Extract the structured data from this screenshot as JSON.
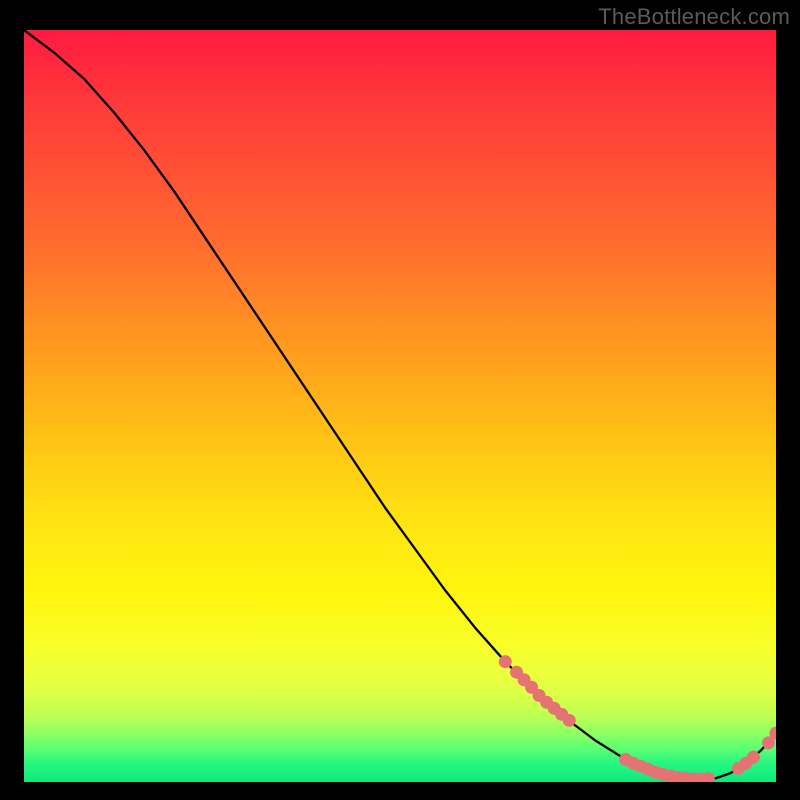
{
  "watermark": "TheBottleneck.com",
  "chart_data": {
    "type": "line",
    "title": "",
    "xlabel": "",
    "ylabel": "",
    "xlim": [
      0,
      100
    ],
    "ylim": [
      0,
      100
    ],
    "grid": false,
    "legend": false,
    "series": [
      {
        "name": "bottleneck-curve",
        "x": [
          0,
          4,
          8,
          12,
          16,
          20,
          24,
          28,
          32,
          36,
          40,
          44,
          48,
          52,
          56,
          60,
          64,
          68,
          72,
          76,
          80,
          82,
          84,
          86,
          88,
          90,
          92,
          94,
          96,
          98,
          100
        ],
        "y": [
          100,
          97,
          93.5,
          89,
          84,
          78.5,
          72.5,
          66.5,
          60.5,
          54.5,
          48.5,
          42.5,
          36.5,
          31,
          25.5,
          20.5,
          16,
          12,
          8.5,
          5.5,
          3,
          2,
          1.2,
          0.7,
          0.4,
          0.4,
          0.5,
          1.2,
          2.5,
          4.2,
          6.5
        ]
      }
    ],
    "marker_clusters": [
      {
        "name": "cluster-mid-slope",
        "color": "#e57373",
        "points": [
          {
            "x": 64.0,
            "y": 16.0
          },
          {
            "x": 65.5,
            "y": 14.6
          },
          {
            "x": 66.5,
            "y": 13.6
          },
          {
            "x": 67.5,
            "y": 12.6
          },
          {
            "x": 68.5,
            "y": 11.5
          },
          {
            "x": 69.5,
            "y": 10.6
          },
          {
            "x": 70.5,
            "y": 9.8
          },
          {
            "x": 71.5,
            "y": 9.0
          },
          {
            "x": 72.5,
            "y": 8.2
          }
        ]
      },
      {
        "name": "cluster-valley",
        "color": "#e57373",
        "points": [
          {
            "x": 80.0,
            "y": 3.0
          },
          {
            "x": 81.0,
            "y": 2.5
          },
          {
            "x": 82.0,
            "y": 2.1
          },
          {
            "x": 83.0,
            "y": 1.7
          },
          {
            "x": 84.0,
            "y": 1.3
          },
          {
            "x": 85.0,
            "y": 1.0
          },
          {
            "x": 86.0,
            "y": 0.8
          },
          {
            "x": 87.0,
            "y": 0.6
          },
          {
            "x": 88.0,
            "y": 0.5
          },
          {
            "x": 89.0,
            "y": 0.4
          },
          {
            "x": 90.0,
            "y": 0.4
          },
          {
            "x": 91.0,
            "y": 0.45
          }
        ]
      },
      {
        "name": "cluster-upturn",
        "color": "#e57373",
        "points": [
          {
            "x": 95.0,
            "y": 1.8
          },
          {
            "x": 96.0,
            "y": 2.5
          },
          {
            "x": 97.0,
            "y": 3.3
          }
        ]
      },
      {
        "name": "cluster-end",
        "color": "#e57373",
        "points": [
          {
            "x": 99.0,
            "y": 5.2
          },
          {
            "x": 100.0,
            "y": 6.5
          }
        ]
      }
    ],
    "background_gradient": {
      "top_color": "#ff1a40",
      "mid_color": "#fff60e",
      "bottom_color": "#0fe87e"
    }
  }
}
